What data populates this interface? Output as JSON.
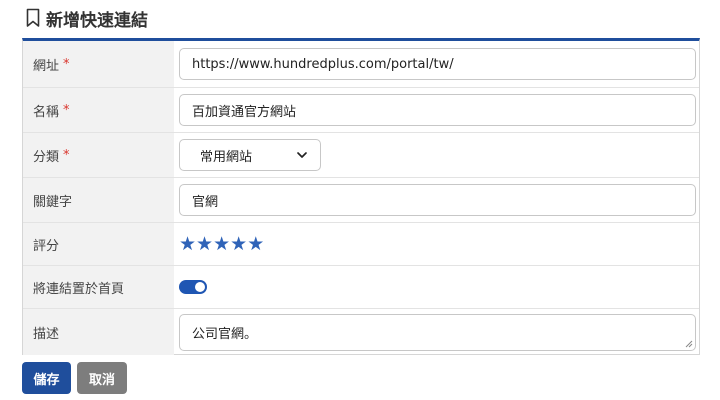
{
  "page": {
    "title": "新增快速連結",
    "title_icon": "bookmark-icon"
  },
  "form": {
    "url": {
      "label": "網址",
      "required_mark": "*",
      "value": "https://www.hundredplus.com/portal/tw/"
    },
    "name": {
      "label": "名稱",
      "required_mark": "*",
      "value": "百加資通官方網站"
    },
    "category": {
      "label": "分類",
      "required_mark": "*",
      "selected": "常用網站"
    },
    "keywords": {
      "label": "關鍵字",
      "value": "官網"
    },
    "rating": {
      "label": "評分",
      "value": 5,
      "max": 5
    },
    "homepage": {
      "label": "將連結置於首頁",
      "enabled": true
    },
    "description": {
      "label": "描述",
      "value": "公司官網。"
    }
  },
  "buttons": {
    "save": "儲存",
    "cancel": "取消"
  },
  "colors": {
    "accent": "#1f4e9c",
    "star": "#2f63b8",
    "required": "#d9342b",
    "cancel": "#7d7d7d"
  }
}
